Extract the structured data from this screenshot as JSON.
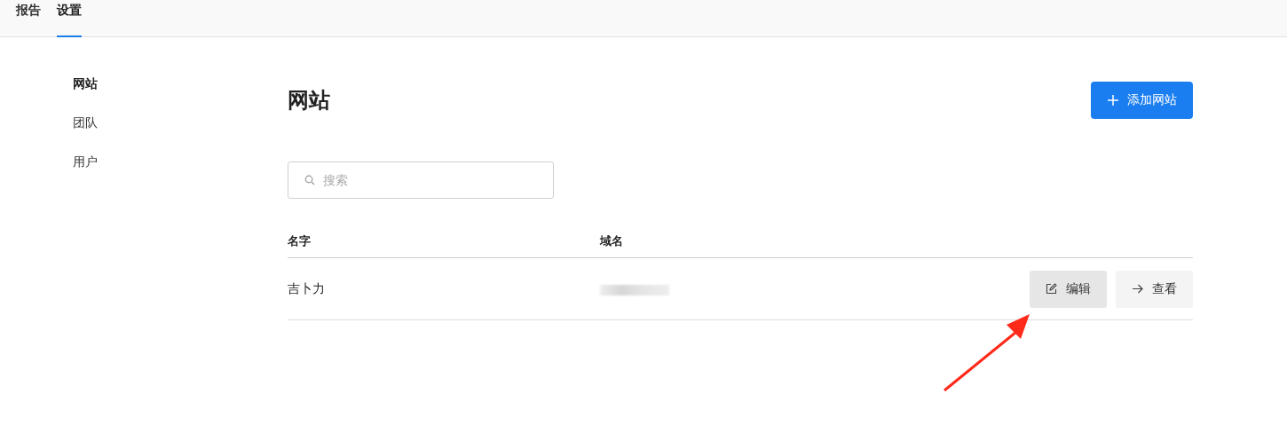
{
  "nav": {
    "tabs": [
      {
        "label": "报告",
        "selected": false
      },
      {
        "label": "设置",
        "selected": true
      }
    ]
  },
  "sidebar": {
    "items": [
      {
        "label": "网站",
        "selected": true
      },
      {
        "label": "团队",
        "selected": false
      },
      {
        "label": "用户",
        "selected": false
      }
    ]
  },
  "page": {
    "title": "网站",
    "add_button": "添加网站"
  },
  "search": {
    "placeholder": "搜索"
  },
  "table": {
    "columns": [
      "名字",
      "域名"
    ],
    "rows": [
      {
        "name": "吉卜力",
        "domain": {
          "kind": "redacted"
        },
        "actions": [
          {
            "kind": "edit",
            "label": "编辑",
            "highlighted": true
          },
          {
            "kind": "view",
            "label": "查看",
            "highlighted": false
          }
        ]
      }
    ]
  },
  "annotation": {
    "kind": "arrow"
  }
}
